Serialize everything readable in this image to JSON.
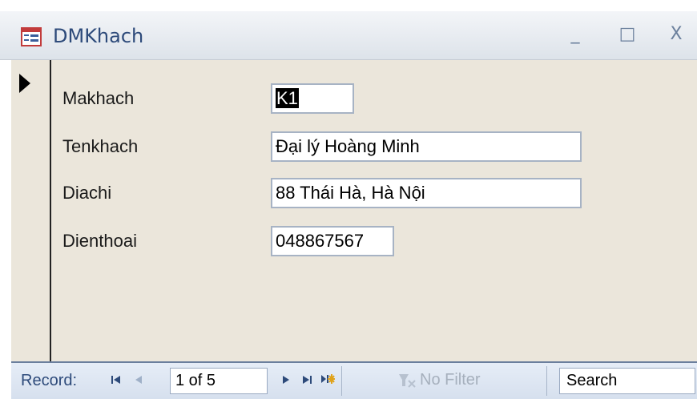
{
  "window": {
    "title": "DMKhach",
    "icon": "form-icon",
    "controls": {
      "minimize": "_",
      "maximize": "□",
      "close": "X"
    }
  },
  "record_selector": {
    "icon": "current-record-arrow-icon"
  },
  "form": {
    "fields": [
      {
        "label": "Makhach",
        "value": "K1"
      },
      {
        "label": "Tenkhach",
        "value": "Đại lý Hoàng Minh"
      },
      {
        "label": "Diachi",
        "value": "88 Thái Hà, Hà Nội"
      },
      {
        "label": "Dienthoai",
        "value": "048867567"
      }
    ]
  },
  "navigation": {
    "label": "Record:",
    "current": "1 of 5",
    "first_icon": "first-record-icon",
    "prev_icon": "previous-record-icon",
    "next_icon": "next-record-icon",
    "last_icon": "last-record-icon",
    "new_icon": "new-record-icon",
    "filter_label": "No Filter",
    "filter_icon": "filter-icon",
    "search_placeholder": "Search"
  },
  "colors": {
    "detail_background": "#ebe6db",
    "title_text": "#2d4a7a",
    "nav_background": "#dce5f1"
  }
}
